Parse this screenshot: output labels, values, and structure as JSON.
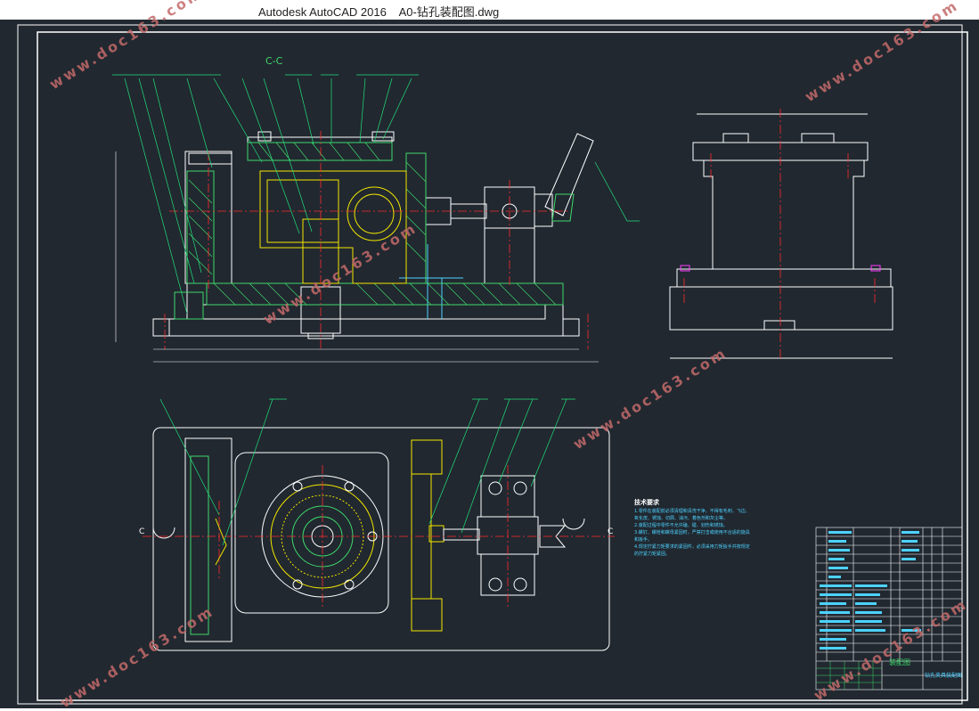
{
  "window": {
    "app_name": "Autodesk AutoCAD 2016",
    "file_name": "A0-钻孔装配图.dwg"
  },
  "drawing": {
    "section_label": "C-C",
    "cut_mark_left": "C",
    "cut_mark_right": "C",
    "tech_requirements": {
      "heading": "技术要求",
      "lines": [
        "1.零件在装配前必须清理和清洗干净，不得有毛刺、飞边、",
        "氧化皮、锈蚀、切屑、油污、着色剂和灰尘等。",
        "2.装配过程中零件不允许磕、碰、划伤和锈蚀。",
        "3.螺钉、螺栓和螺母紧固时，严禁打击或使用不合适的旋具和扳手。",
        "4.规定拧紧力矩要求的紧固件，必须采用力矩扳手并按规定的拧紧力矩紧固。"
      ]
    },
    "title_block": {
      "drawing_name": "装配图",
      "part_name": "钻孔夹具装配图"
    }
  },
  "watermark": {
    "text": "www.doc163.com"
  },
  "colors": {
    "background": "#212830",
    "outline": "#ffffff",
    "section_hatch": "#3fd86a",
    "centerline": "#ff2b2b",
    "part_yellow": "#f2e600",
    "leader": "#22e07a",
    "dimension": "#4dd2ff",
    "magenta": "#ff3cff"
  }
}
